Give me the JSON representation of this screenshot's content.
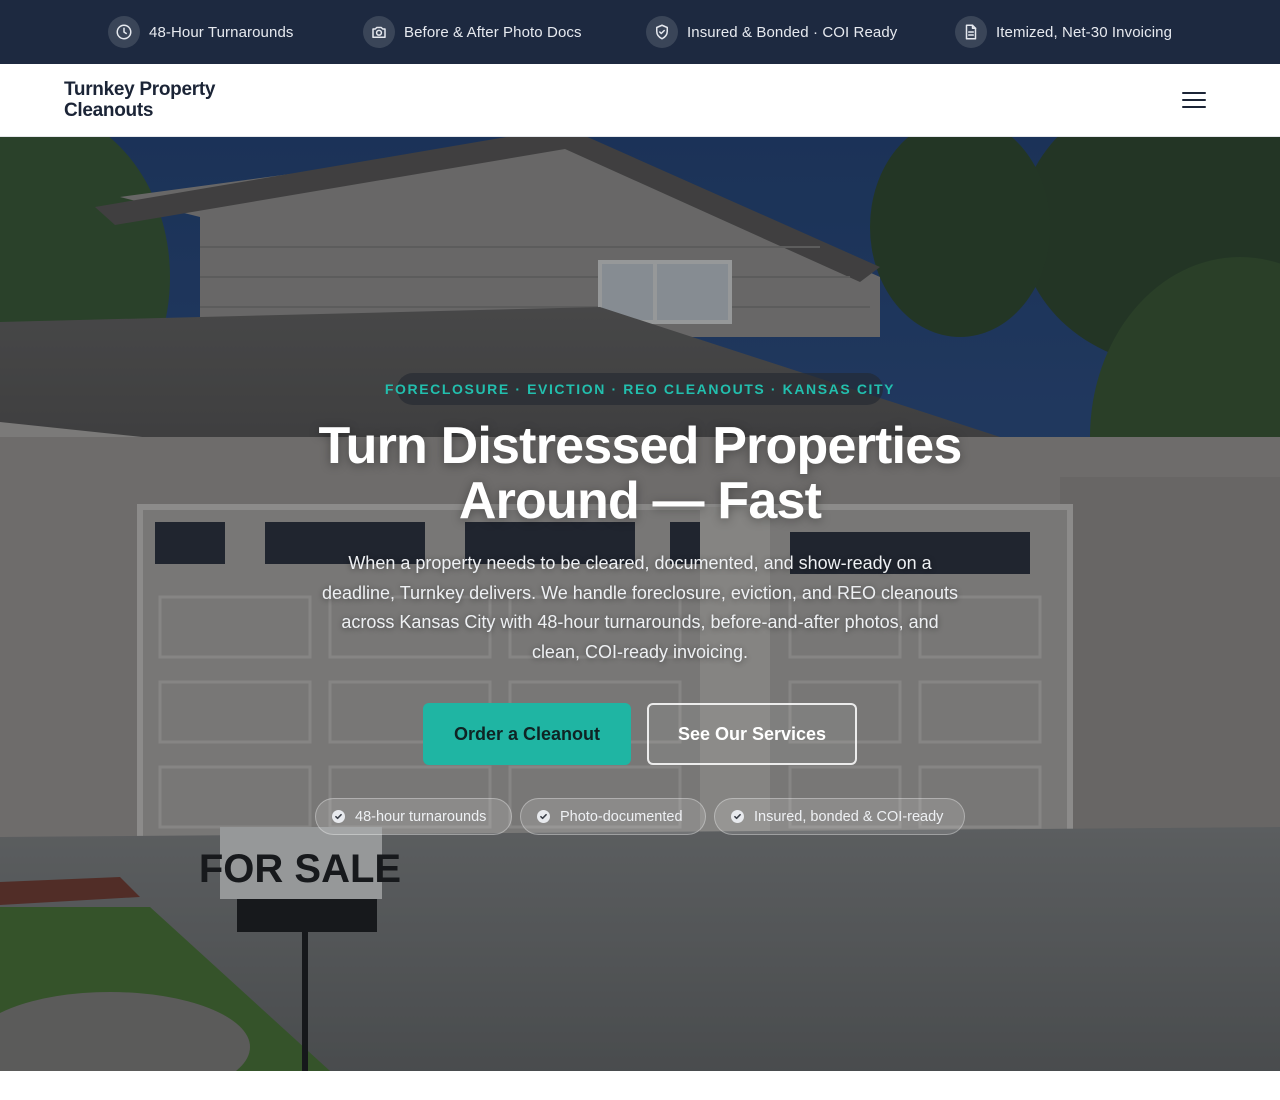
{
  "trust_bar": {
    "items": [
      {
        "label": "48-Hour Turnarounds",
        "icon": "clock-icon"
      },
      {
        "label": "Before & After Photo Docs",
        "icon": "camera-icon"
      },
      {
        "label": "Insured & Bonded · COI Ready",
        "icon": "shield-check-icon"
      },
      {
        "label": "Itemized, Net-30 Invoicing",
        "icon": "document-icon"
      }
    ]
  },
  "header": {
    "logo_line1": "Turnkey Property",
    "logo_line2": "Cleanouts",
    "menu_icon": "hamburger-menu-icon"
  },
  "hero": {
    "eyebrow": "FORECLOSURE · EVICTION · REO CLEANOUTS · KANSAS CITY",
    "headline_line1": "Turn Distressed Properties",
    "headline_line2": "Around — Fast",
    "subhead": "When a property needs to be cleared, documented, and show-ready on a deadline, Turnkey delivers. We handle foreclosure, eviction, and REO cleanouts across Kansas City with 48-hour turnarounds, before-and-after photos, and clean, COI-ready invoicing.",
    "primary_cta": "Order a Cleanout",
    "secondary_cta": "See Our Services",
    "badges": [
      {
        "label": "48-hour turnarounds",
        "icon": "check-circle-icon"
      },
      {
        "label": "Photo-documented",
        "icon": "check-circle-icon"
      },
      {
        "label": "Insured, bonded & COI-ready",
        "icon": "check-circle-icon"
      }
    ],
    "sign_text": "FOR SALE"
  },
  "colors": {
    "topbar_bg": "#1d2940",
    "accent": "#1fb5a3",
    "heading_text": "#1b2436"
  }
}
